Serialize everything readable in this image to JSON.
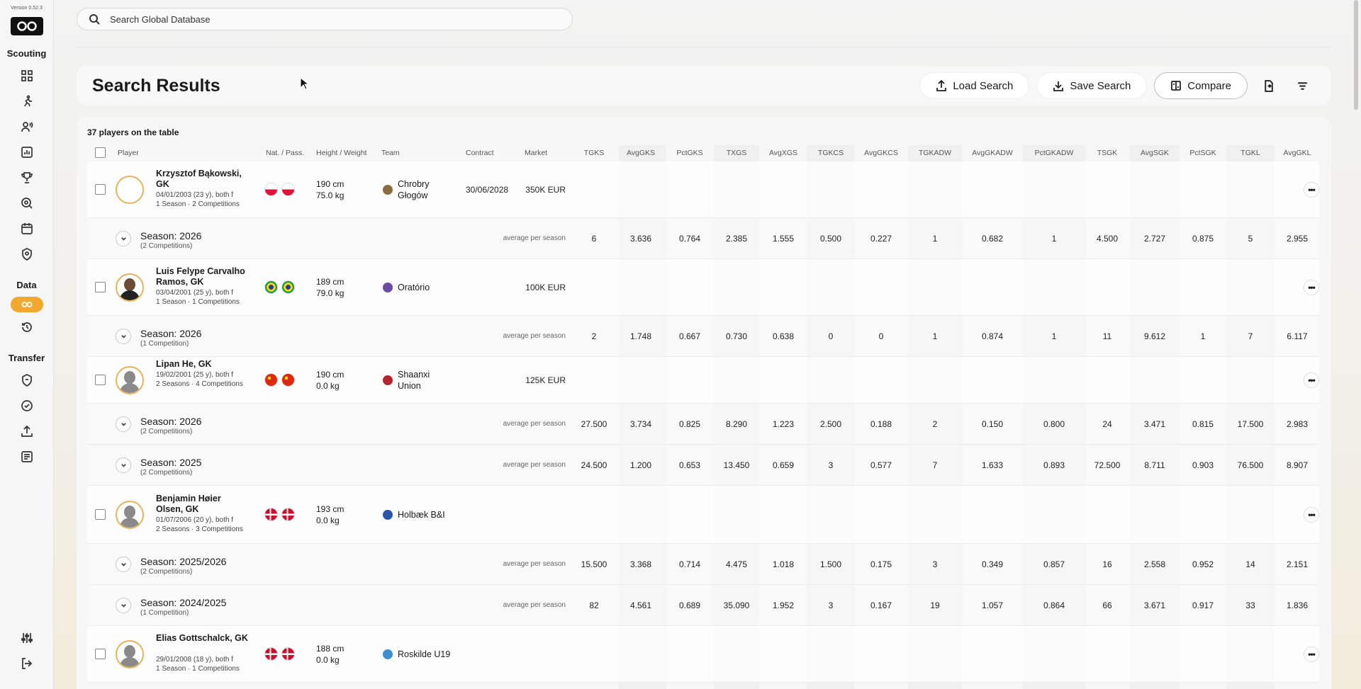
{
  "app": {
    "version": "Version 0.52.3"
  },
  "sidebar": {
    "sections": [
      {
        "label": "Scouting"
      },
      {
        "label": "Data"
      },
      {
        "label": "Transfer"
      }
    ]
  },
  "search": {
    "placeholder": "Search Global Database"
  },
  "header": {
    "title": "Search Results",
    "load_label": "Load Search",
    "save_label": "Save Search",
    "compare_label": "Compare"
  },
  "table": {
    "count_label": "37 players on the table",
    "headers": {
      "player": "Player",
      "nat": "Nat. / Pass.",
      "hw": "Height / Weight",
      "team": "Team",
      "contract": "Contract",
      "market": "Market"
    },
    "stat_headers": [
      "TGKS",
      "AvgGKS",
      "PctGKS",
      "TXGS",
      "AvgXGS",
      "TGKCS",
      "AvgGKCS",
      "TGKADW",
      "AvgGKADW",
      "PctGKADW",
      "TSGK",
      "AvgSGK",
      "PctSGK",
      "TGKL",
      "AvgGKL"
    ],
    "avg_label": "average per season",
    "players": [
      {
        "name": "Krzysztof Bąkowski, GK",
        "meta1": "04/01/2003 (23 y), both f",
        "meta2": "1 Season · 2 Competitions",
        "flags": [
          "poland",
          "poland"
        ],
        "height": "190 cm",
        "weight": "75.0 kg",
        "team": "Chrobry Głogów",
        "contract": "30/06/2028",
        "market": "350K EUR",
        "avatar": "empty",
        "seasons": [
          {
            "title": "Season: 2026",
            "sub": "(2 Competitions)",
            "stats": [
              "6",
              "3.636",
              "0.764",
              "2.385",
              "1.555",
              "0.500",
              "0.227",
              "1",
              "0.682",
              "1",
              "4.500",
              "2.727",
              "0.875",
              "5",
              "2.955"
            ]
          }
        ]
      },
      {
        "name": "Luis Felype Carvalho Ramos, GK",
        "meta1": "03/04/2001 (25 y), both f",
        "meta2": "1 Season · 1 Competitions",
        "flags": [
          "brazil",
          "brazil"
        ],
        "height": "189 cm",
        "weight": "79.0 kg",
        "team": "Oratório",
        "contract": "",
        "market": "100K EUR",
        "avatar": "dark",
        "seasons": [
          {
            "title": "Season: 2026",
            "sub": "(1 Competition)",
            "stats": [
              "2",
              "1.748",
              "0.667",
              "0.730",
              "0.638",
              "0",
              "0",
              "1",
              "0.874",
              "1",
              "11",
              "9.612",
              "1",
              "7",
              "6.117"
            ]
          }
        ]
      },
      {
        "name": "Lipan He, GK",
        "meta1": "19/02/2001 (25 y), both f",
        "meta2": "2 Seasons · 4 Competitions",
        "flags": [
          "china",
          "china"
        ],
        "height": "190 cm",
        "weight": "0.0 kg",
        "team": "Shaanxi Union",
        "contract": "",
        "market": "125K EUR",
        "avatar": "grey",
        "seasons": [
          {
            "title": "Season: 2026",
            "sub": "(2 Competitions)",
            "stats": [
              "27.500",
              "3.734",
              "0.825",
              "8.290",
              "1.223",
              "2.500",
              "0.188",
              "2",
              "0.150",
              "0.800",
              "24",
              "3.471",
              "0.815",
              "17.500",
              "2.983"
            ]
          },
          {
            "title": "Season: 2025",
            "sub": "(2 Competitions)",
            "stats": [
              "24.500",
              "1.200",
              "0.653",
              "13.450",
              "0.659",
              "3",
              "0.577",
              "7",
              "1.633",
              "0.893",
              "72.500",
              "8.711",
              "0.903",
              "76.500",
              "8.907"
            ]
          }
        ]
      },
      {
        "name": "Benjamin Høier Olsen, GK",
        "meta1": "01/07/2006 (20 y), both f",
        "meta2": "2 Seasons · 3 Competitions",
        "flags": [
          "denmark",
          "denmark"
        ],
        "height": "193 cm",
        "weight": "0.0 kg",
        "team": "Holbæk B&I",
        "contract": "",
        "market": "",
        "avatar": "grey",
        "seasons": [
          {
            "title": "Season: 2025/2026",
            "sub": "(2 Competitions)",
            "stats": [
              "15.500",
              "3.368",
              "0.714",
              "4.475",
              "1.018",
              "1.500",
              "0.175",
              "3",
              "0.349",
              "0.857",
              "16",
              "2.558",
              "0.952",
              "14",
              "2.151"
            ]
          },
          {
            "title": "Season: 2024/2025",
            "sub": "(1 Competition)",
            "stats": [
              "82",
              "4.561",
              "0.689",
              "35.090",
              "1.952",
              "3",
              "0.167",
              "19",
              "1.057",
              "0.864",
              "66",
              "3.671",
              "0.917",
              "33",
              "1.836"
            ]
          }
        ]
      },
      {
        "name": "Elias Gottschalck, GK",
        "meta1": "29/01/2008 (18 y), both f",
        "meta2": "1 Season · 1 Competitions",
        "flags": [
          "denmark",
          "denmark"
        ],
        "height": "188 cm",
        "weight": "0.0 kg",
        "team": "Roskilde U19",
        "contract": "",
        "market": "",
        "avatar": "grey",
        "seasons": []
      }
    ]
  }
}
